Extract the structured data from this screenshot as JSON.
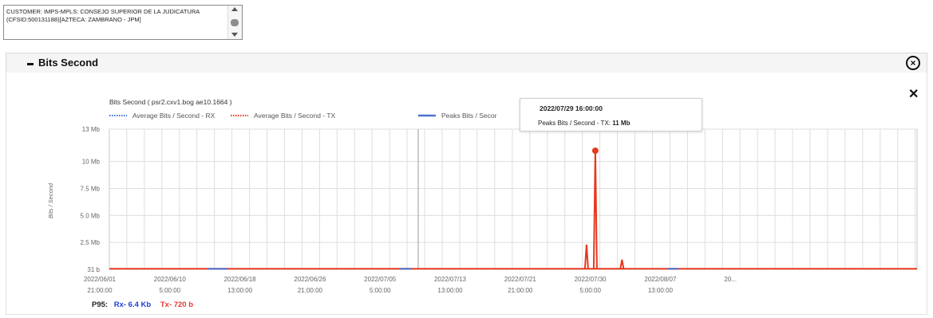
{
  "customer": {
    "text": "CUSTOMER: IMPS-MPLS: CONSEJO SUPERIOR DE LA JUDICATURA (CFSID:500131188)[AZTECA: ZAMBRANO - JPM]"
  },
  "panel": {
    "title": "Bits Second"
  },
  "tooltip": {
    "date": "2022/07/29 16:00:00",
    "series_label": "Peaks Bits / Second - TX:",
    "value": "11 Mb"
  },
  "p95": {
    "label": "P95:",
    "rx": "Rx- 6.4 Kb",
    "tx": "Tx- 720 b"
  },
  "colors": {
    "rx": "#3b6fd6",
    "tx": "#e53a1e",
    "peaks_rx": "#4a74d0",
    "grid": "#dedede"
  },
  "chart_data": {
    "type": "line",
    "title": "Bits Second ( psr2.cxv1.bog ae10.1664 )",
    "ylabel": "Bits / Second",
    "xlabel": "",
    "legend": [
      {
        "label": "Average Bits / Second - RX",
        "style": "dotted",
        "color": "#3b6fd6"
      },
      {
        "label": "Average Bits / Second - TX",
        "style": "dotted",
        "color": "#e53a1e"
      },
      {
        "label": "Peaks Bits / Secor",
        "style": "solid",
        "color": "#4a74d0"
      }
    ],
    "legend_position": "top",
    "y_ticks": [
      "31 b",
      "2.5 Mb",
      "5.0 Mb",
      "7.5 Mb",
      "10 Mb",
      "13 Mb"
    ],
    "y_tick_values": [
      0,
      2.5,
      5,
      7.5,
      10,
      13
    ],
    "ylim": [
      0,
      13
    ],
    "x_ticks": [
      {
        "date": "2022/06/01",
        "time": "21:00:00"
      },
      {
        "date": "2022/06/10",
        "time": "5:00:00"
      },
      {
        "date": "2022/06/18",
        "time": "13:00:00"
      },
      {
        "date": "2022/06/26",
        "time": "21:00:00"
      },
      {
        "date": "2022/07/05",
        "time": "5:00:00"
      },
      {
        "date": "2022/07/13",
        "time": "13:00:00"
      },
      {
        "date": "2022/07/21",
        "time": "21:00:00"
      },
      {
        "date": "2022/07/30",
        "time": "5:00:00"
      },
      {
        "date": "2022/08/07",
        "time": "13:00:00"
      },
      {
        "date": "20...",
        "time": ""
      }
    ],
    "series": [
      {
        "name": "Peaks Bits / Second - TX",
        "color": "#e53a1e",
        "baseline_mbps": 0.0007,
        "spikes": [
          {
            "x": "2022/07/28 15:00:00",
            "value_mbps": 2.3
          },
          {
            "x": "2022/07/29 16:00:00",
            "value_mbps": 11
          },
          {
            "x": "2022/08/01 20:00:00",
            "value_mbps": 0.9
          }
        ]
      }
    ],
    "highlighted_point": {
      "x": "2022/07/29 16:00:00",
      "value_mbps": 11
    },
    "grid": true
  }
}
